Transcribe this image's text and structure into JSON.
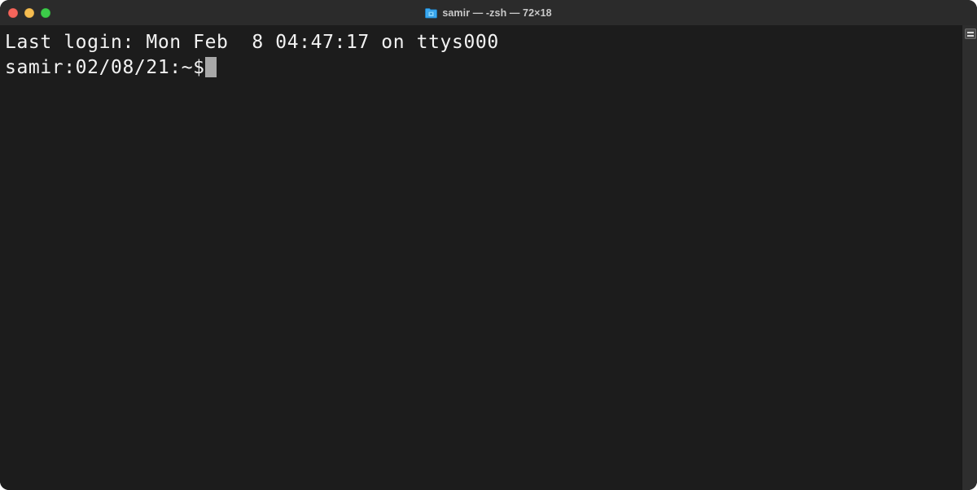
{
  "window": {
    "title": "samir — -zsh — 72×18",
    "proxy_icon": "folder-icon",
    "background_color": "#1c1c1c",
    "titlebar_color": "#2b2b2b",
    "text_color": "#f2f2f2",
    "controls": {
      "close_label": "close-button",
      "minimize_label": "minimize-button",
      "maximize_label": "maximize-button",
      "close_color": "#f5655b",
      "minimize_color": "#f6bd50",
      "maximize_color": "#3ccc49"
    }
  },
  "terminal": {
    "lines": [
      "Last login: Mon Feb  8 04:47:17 on ttys000",
      "samir:02/08/21:~$"
    ],
    "cursor": {
      "visible": true,
      "color": "#a8a8a8",
      "style": "block"
    }
  },
  "scrollbar": {
    "name": "vertical-scrollbar",
    "thumb_position": "top"
  }
}
